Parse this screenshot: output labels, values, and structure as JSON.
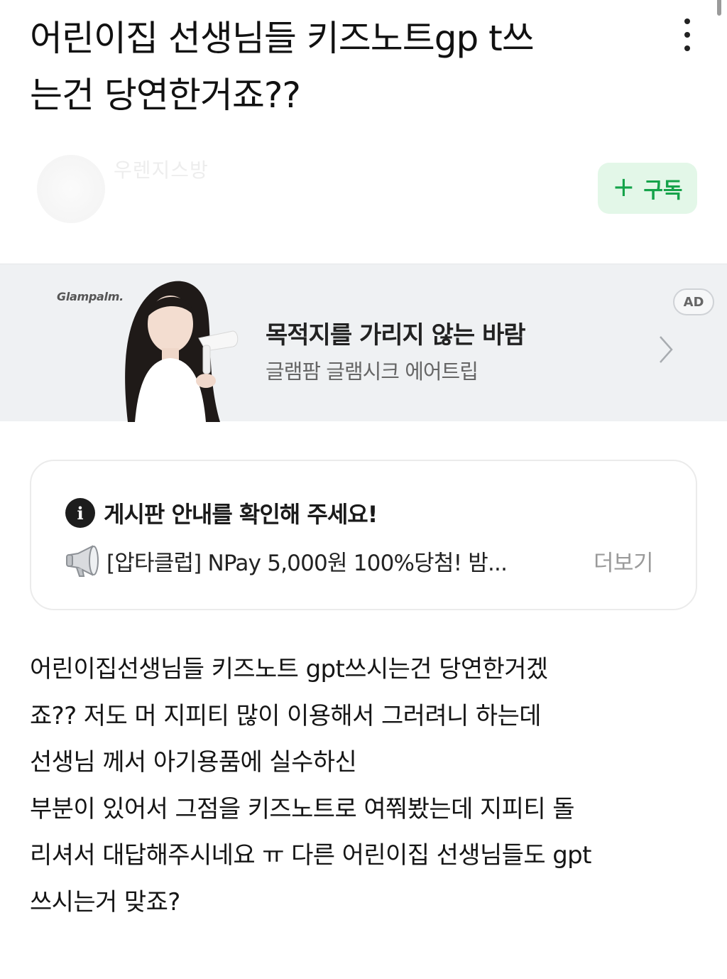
{
  "header": {
    "title_lines": [
      "어린이집 선생님들 키즈노트gp t쓰",
      "는건 당연한거죠??"
    ]
  },
  "author": {
    "name": "우렌지스방",
    "meta": "",
    "subscribe_label": "구독",
    "subscribe_icon": "plus-icon",
    "subscribe_color": "#15a34a"
  },
  "ad": {
    "brand": "Glampalm.",
    "headline": "목적지를 가리지 않는 바람",
    "subtitle": "글램팜 글램시크 에어트립",
    "badge": "AD",
    "background": "#eff1f3"
  },
  "notice": {
    "title": "게시판 안내를 확인해 주세요!",
    "info_icon": "info-icon",
    "item_icon": "megaphone-icon",
    "item_text": "[압타클럽] NPay 5,000원 100%당첨! 밤...",
    "more_label": "더보기"
  },
  "body": {
    "lines": [
      "어린이집선생님들 키즈노트 gpt쓰시는건 당연한거겠",
      "죠?? 저도 머 지피티 많이 이용해서 그러려니 하는데",
      "선생님 께서 아기용품에 실수하신",
      "부분이 있어서 그점을 키즈노트로 여쭤봤는데  지피티 돌",
      "리셔서 대답해주시네요 ㅠ 다른 어린이집 선생님들도  gpt",
      "쓰시는거 맞죠?"
    ]
  }
}
